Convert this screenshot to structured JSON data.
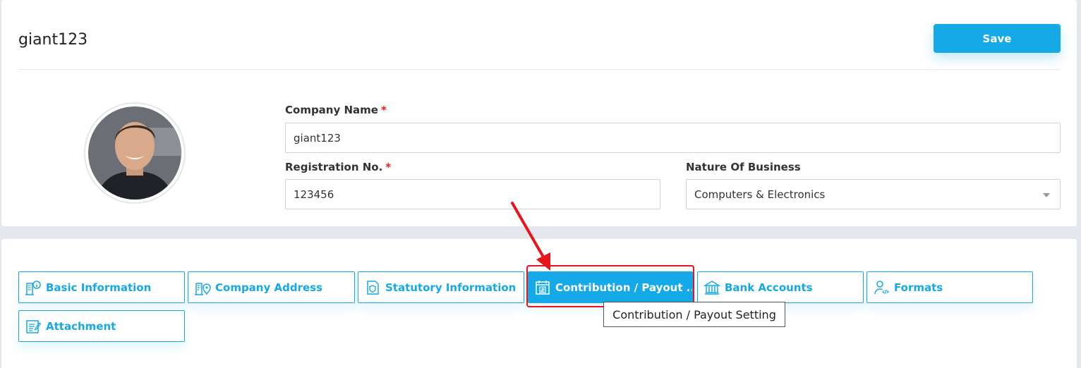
{
  "header": {
    "title": "giant123",
    "save_label": "Save"
  },
  "form": {
    "company_name": {
      "label": "Company Name",
      "required_mark": "*",
      "value": "giant123"
    },
    "registration_no": {
      "label": "Registration No.",
      "required_mark": "*",
      "value": "123456"
    },
    "nature_of_business": {
      "label": "Nature Of Business",
      "value": "Computers & Electronics"
    }
  },
  "tabs": [
    {
      "label": "Basic Information",
      "icon": "building-info-icon"
    },
    {
      "label": "Company Address",
      "icon": "building-location-icon"
    },
    {
      "label": "Statutory Information",
      "icon": "shield-document-icon"
    },
    {
      "label": "Contribution / Payout ...",
      "icon": "payout-calendar-icon",
      "active": true
    },
    {
      "label": "Bank Accounts",
      "icon": "bank-icon"
    },
    {
      "label": "Formats",
      "icon": "user-code-icon"
    },
    {
      "label": "Attachment",
      "icon": "document-edit-icon"
    }
  ],
  "tooltip": "Contribution / Payout Setting",
  "colors": {
    "accent": "#15a9e8",
    "annotation": "#e8131b",
    "required": "#e02020"
  }
}
